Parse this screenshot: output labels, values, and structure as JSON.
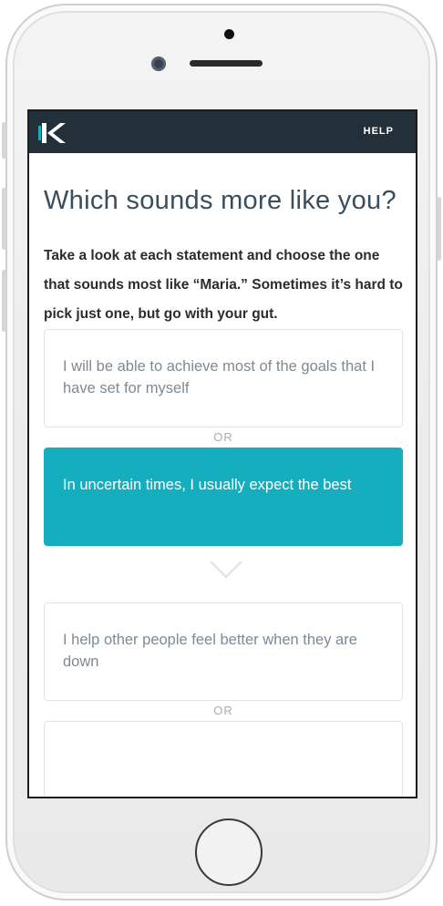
{
  "topbar": {
    "logo_icon": "k-logo-icon",
    "help_label": "HELP",
    "background": "#23303a"
  },
  "page": {
    "title": "Which sounds more like you?",
    "intro": "Take a look at each statement and choose the one that sounds most like “Maria.” Sometimes it’s hard to pick just one, but go with your gut."
  },
  "questions": [
    {
      "option_a": "I will be able to achieve most of the goals that I have set for myself",
      "separator": "OR",
      "option_b": "In uncertain times, I usually expect the best",
      "selected": "option_b"
    },
    {
      "option_a": "I help other people feel better when they are down",
      "separator": "OR"
    }
  ],
  "next_icon": "chevron-down-icon",
  "colors": {
    "accent": "#15aebf",
    "title": "#3a4e5e",
    "option_text": "#7d8a94"
  }
}
